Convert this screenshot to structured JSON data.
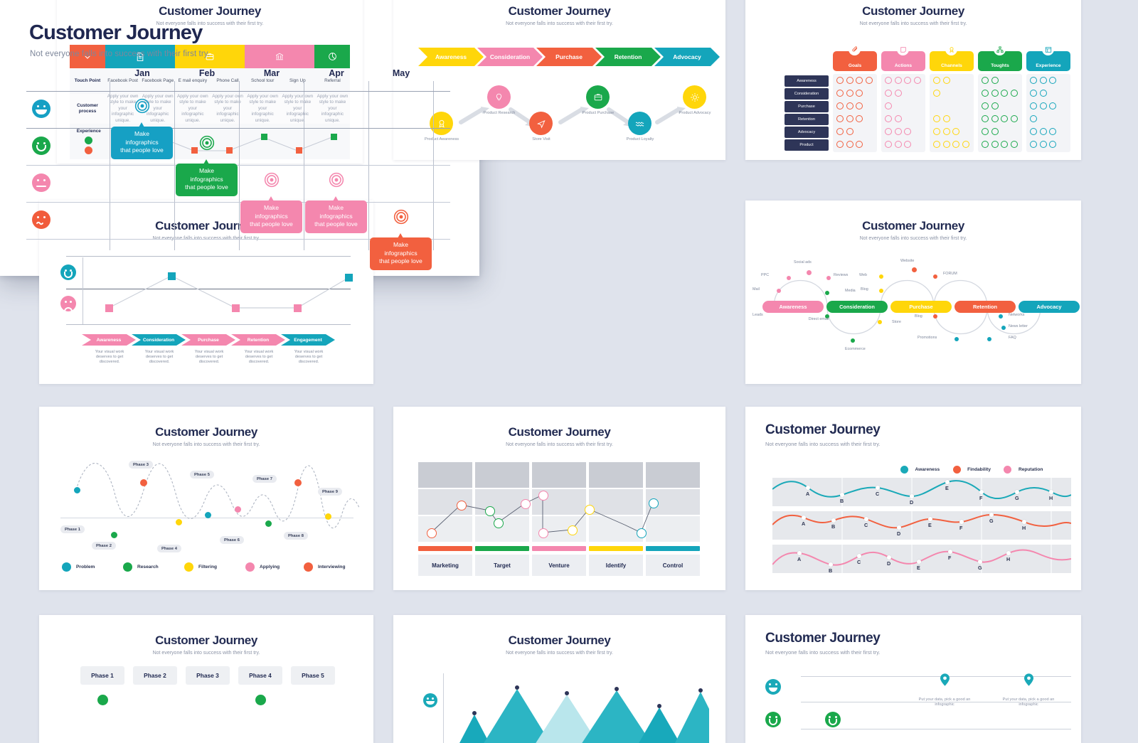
{
  "meta": {
    "background_color": "#dfe3ec",
    "headline": "Customer Journey",
    "subhead": "Not everyone falls into success with their first try."
  },
  "front_slide": {
    "title": "Customer Journey",
    "subtitle": "Not everyone falls into success with their first try.",
    "months": [
      "Jan",
      "Feb",
      "Mar",
      "Apr",
      "May"
    ],
    "moods": [
      {
        "name": "very-happy-face",
        "color": "#16a0c4"
      },
      {
        "name": "happy-face",
        "color": "#1aa84b"
      },
      {
        "name": "neutral-face",
        "color": "#f487ae"
      },
      {
        "name": "sad-face",
        "color": "#f15c3c"
      }
    ],
    "callout_text_lines": [
      "Make",
      "infographics",
      "that people love"
    ],
    "markers": [
      {
        "month": "Jan",
        "mood": "very-happy-face",
        "color": "#16a0c4",
        "text": "Make infographics that people love"
      },
      {
        "month": "Feb",
        "mood": "happy-face",
        "color": "#1aa84b",
        "text": "Make infographics that people love"
      },
      {
        "month": "Mar",
        "mood": "neutral-face",
        "color": "#f487ae",
        "text": "Make infographics that people love"
      },
      {
        "month": "Apr",
        "mood": "neutral-face",
        "color": "#f487ae",
        "text": "Make infographics that people love"
      },
      {
        "month": "May",
        "mood": "sad-face",
        "color": "#f2603f",
        "text": "Make infographics that people love"
      }
    ]
  },
  "chart_data": {
    "type": "scatter",
    "title": "Customer Journey",
    "subtitle": "Not everyone falls into success with their first try.",
    "xlabel": "",
    "ylabel": "",
    "categories": [
      "Jan",
      "Feb",
      "Mar",
      "Apr",
      "May"
    ],
    "y_categories": [
      "very-happy",
      "happy",
      "neutral",
      "sad"
    ],
    "points": [
      {
        "x": "Jan",
        "y": "very-happy",
        "label": "Make infographics that people love",
        "color": "#16a0c4"
      },
      {
        "x": "Feb",
        "y": "happy",
        "label": "Make infographics that people love",
        "color": "#1aa84b"
      },
      {
        "x": "Mar",
        "y": "neutral",
        "label": "Make infographics that people love",
        "color": "#f487ae"
      },
      {
        "x": "Apr",
        "y": "neutral",
        "label": "Make infographics that people love",
        "color": "#f487ae"
      },
      {
        "x": "May",
        "y": "sad",
        "label": "Make infographics that people love",
        "color": "#f2603f"
      }
    ],
    "grid": true,
    "legend": "none"
  },
  "slide1": {
    "title": "Customer Journey",
    "subtitle": "Not everyone falls into success with their first try.",
    "header_colors": [
      "#f2603f",
      "#14a5bb",
      "#ffd60a",
      "#f487ae",
      "#1aa84b"
    ],
    "row_labels": [
      "Touch Point",
      "Customer process",
      "Experience"
    ],
    "touchpoints": [
      "Facebook Post",
      "Facebook Page",
      "E mail enquiry",
      "Phone Call",
      "School tour",
      "Sign Up",
      "Referral"
    ],
    "process_text": "Apply your own style to make your infographic unique.",
    "experience_points": [
      "sad",
      "happy",
      "sad",
      "sad",
      "happy",
      "sad",
      "happy"
    ]
  },
  "slide2": {
    "title": "Customer Journey",
    "subtitle": "Not everyone falls into success with their first try.",
    "stages": [
      "Awareness",
      "Consideration",
      "Purchase",
      "Retention",
      "Advocacy"
    ],
    "stage_colors": [
      "#ffd60a",
      "#f487ae",
      "#f2603f",
      "#1aa84b",
      "#14a5bb"
    ],
    "nodes": [
      {
        "label": "Product Awareness",
        "icon": "badge-icon",
        "color": "#ffd60a"
      },
      {
        "label": "Product Research",
        "icon": "bulb-icon",
        "color": "#f487ae"
      },
      {
        "label": "Store Visit",
        "icon": "send-icon",
        "color": "#f2603f"
      },
      {
        "label": "Product Purchase",
        "icon": "briefcase-icon",
        "color": "#1aa84b"
      },
      {
        "label": "Product Loyalty",
        "icon": "wave-icon",
        "color": "#14a5bb"
      },
      {
        "label": "Product Advocacy",
        "icon": "sun-icon",
        "color": "#ffd60a"
      }
    ]
  },
  "slide3": {
    "title": "Customer Journey",
    "subtitle": "Not everyone falls into success with their first try.",
    "columns": [
      {
        "label": "Goals",
        "color": "#f2603f",
        "icon": "clip-icon"
      },
      {
        "label": "Actions",
        "color": "#f487ae",
        "icon": "note-icon"
      },
      {
        "label": "Channels",
        "color": "#ffd60a",
        "icon": "badge-icon"
      },
      {
        "label": "Toughts",
        "color": "#1aa84b",
        "icon": "sitemap-icon"
      },
      {
        "label": "Experience",
        "color": "#14a5bb",
        "icon": "table-icon"
      }
    ],
    "rows": [
      "Awareness",
      "Consideration",
      "Purchase",
      "Retention",
      "Advocacy",
      "Product"
    ],
    "counts": [
      [
        4,
        4,
        2,
        2,
        3
      ],
      [
        3,
        2,
        1,
        4,
        2
      ],
      [
        3,
        1,
        0,
        2,
        3
      ],
      [
        3,
        2,
        2,
        4,
        1
      ],
      [
        2,
        3,
        3,
        2,
        3
      ],
      [
        3,
        3,
        4,
        4,
        3
      ]
    ]
  },
  "slide4": {
    "title": "Customer Journey",
    "subtitle": "Not everyone falls into success with their first try.",
    "stages": [
      "Awareness",
      "Consideration",
      "Purchase",
      "Retention",
      "Engagement"
    ],
    "stage_colors": [
      "#f487ae",
      "#14a5bb",
      "#f487ae",
      "#f487ae",
      "#14a5bb"
    ],
    "stage_caption": "Your visual work deserves to get discovered.",
    "series_values": [
      "low",
      "high",
      "low",
      "low",
      "high"
    ],
    "happy_color": "#14a5bb",
    "sad_color": "#f487ae"
  },
  "slide6": {
    "title": "Customer Journey",
    "subtitle": "Not everyone falls into success with their first try.",
    "stages": [
      "Awareness",
      "Consideration",
      "Purchase",
      "Retention",
      "Advocacy"
    ],
    "stage_colors": [
      "#f487ae",
      "#1aa84b",
      "#ffd60a",
      "#f2603f",
      "#14a5bb"
    ],
    "labels_top": [
      "PPC",
      "Social ads",
      "Reviews",
      "Web",
      "Website",
      "FORUM"
    ],
    "labels_left": [
      "Mail",
      "Leads"
    ],
    "labels_mid": [
      "Media",
      "Blog"
    ],
    "labels_bottom": [
      "Direct email",
      "Ecommerce",
      "Store",
      "Blog",
      "Promotions",
      "Networks",
      "News letter",
      "FAQ"
    ]
  },
  "slide7": {
    "title": "Customer Journey",
    "subtitle": "Not everyone falls into success with their first try.",
    "phases": [
      "Phase 1",
      "Phase 2",
      "Phase 3",
      "Phase 4",
      "Phase 5",
      "Phase 6",
      "Phase 7",
      "Phase 8",
      "Phase 9"
    ],
    "legend": [
      {
        "label": "Problem",
        "color": "#14a5bb"
      },
      {
        "label": "Research",
        "color": "#1aa84b"
      },
      {
        "label": "Filtering",
        "color": "#ffd60a"
      },
      {
        "label": "Applying",
        "color": "#f487ae"
      },
      {
        "label": "Interviewing",
        "color": "#f2603f"
      }
    ]
  },
  "slide8": {
    "title": "Customer Journey",
    "subtitle": "Not everyone falls into success with their first try.",
    "columns": [
      "Marketing",
      "Target",
      "Venture",
      "Identify",
      "Control"
    ],
    "column_colors": [
      "#f2603f",
      "#1aa84b",
      "#f487ae",
      "#ffd60a",
      "#14a5bb"
    ]
  },
  "slide9": {
    "title": "Customer Journey",
    "subtitle": "Not everyone falls into success with their first try.",
    "legend": [
      {
        "label": "Awareness",
        "color": "#1aa9b8"
      },
      {
        "label": "Findability",
        "color": "#f2603f"
      },
      {
        "label": "Reputation",
        "color": "#f487ae"
      }
    ],
    "point_labels": [
      "A",
      "B",
      "C",
      "D",
      "E",
      "F",
      "G",
      "H"
    ]
  },
  "slide10": {
    "title": "Customer Journey",
    "subtitle": "Not everyone falls into success with their first try.",
    "phases": [
      "Phase 1",
      "Phase 2",
      "Phase 3",
      "Phase 4",
      "Phase 5"
    ]
  },
  "slide11": {
    "title": "Customer Journey",
    "subtitle": "Not everyone falls into success with their first try."
  },
  "slide12": {
    "title": "Customer Journey",
    "subtitle": "Not everyone falls into success with their first try.",
    "pin_caption": "Put your data, pick a good an infographic"
  }
}
